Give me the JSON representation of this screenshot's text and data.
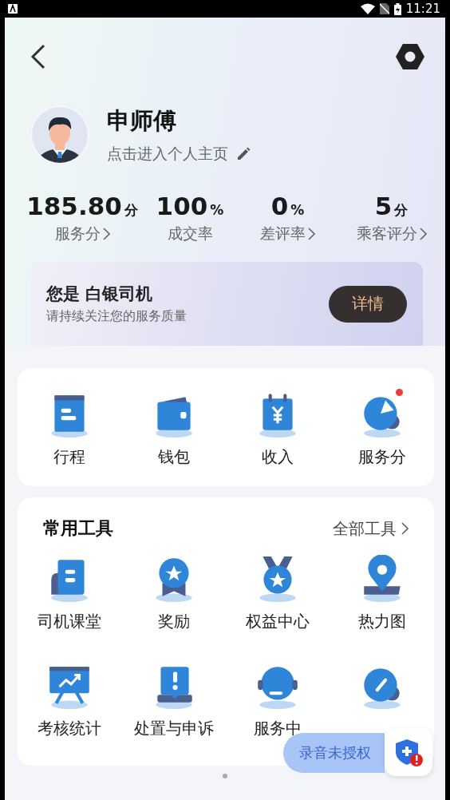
{
  "status_bar": {
    "time": "11:21"
  },
  "profile": {
    "name": "申师傅",
    "subtitle": "点击进入个人主页"
  },
  "stats": [
    {
      "value": "185.80",
      "unit": "分",
      "label": "服务分",
      "link": true
    },
    {
      "value": "100",
      "unit": "%",
      "label": "成交率",
      "link": false
    },
    {
      "value": "0",
      "unit": "%",
      "label": "差评率",
      "link": true
    },
    {
      "value": "5",
      "unit": "分",
      "label": "乘客评分",
      "link": true
    }
  ],
  "level_banner": {
    "prefix": "您是",
    "level": "白银司机",
    "subtitle": "请持续关注您的服务质量",
    "button": "详情"
  },
  "shortcuts": [
    {
      "label": "行程",
      "kind": "notebook",
      "badge": false
    },
    {
      "label": "钱包",
      "kind": "wallet",
      "badge": false
    },
    {
      "label": "收入",
      "kind": "calendar",
      "badge": false
    },
    {
      "label": "服务分",
      "kind": "pie",
      "badge": true
    }
  ],
  "tools": {
    "title": "常用工具",
    "more": "全部工具",
    "items": [
      {
        "label": "司机课堂",
        "kind": "book"
      },
      {
        "label": "奖励",
        "kind": "award"
      },
      {
        "label": "权益中心",
        "kind": "medal"
      },
      {
        "label": "热力图",
        "kind": "pin"
      },
      {
        "label": "考核统计",
        "kind": "chart"
      },
      {
        "label": "处置与申诉",
        "kind": "alert"
      },
      {
        "label": "服务中",
        "kind": "headset"
      },
      {
        "kind": "gauge"
      }
    ]
  },
  "recording_banner": {
    "label": "录音未授权"
  }
}
